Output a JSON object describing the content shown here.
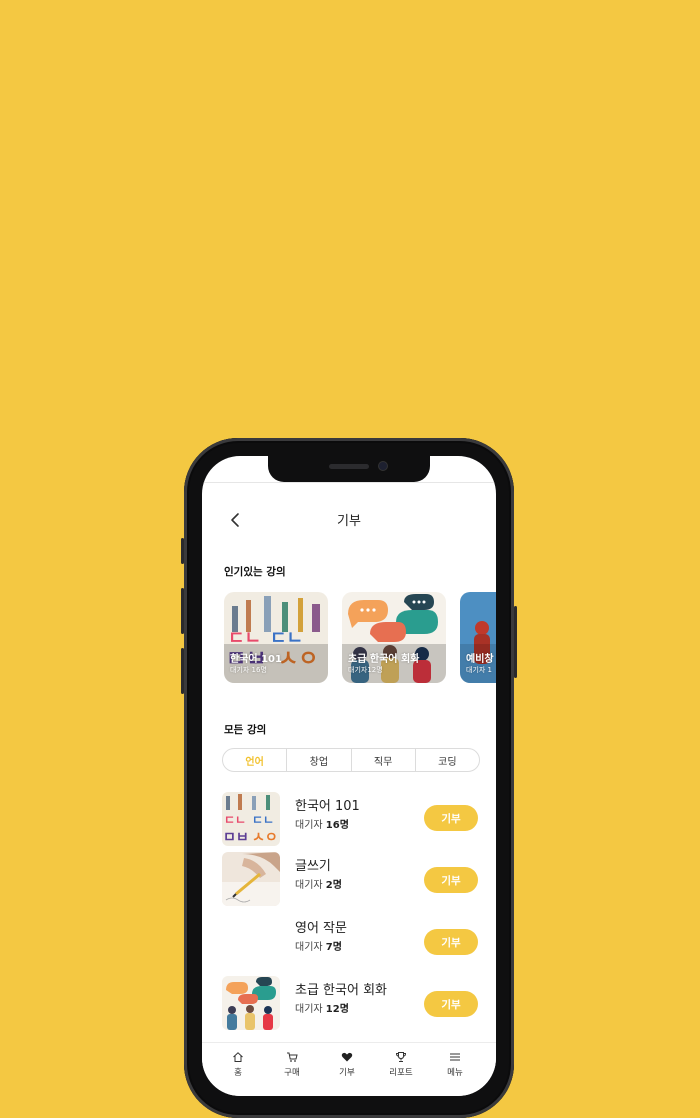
{
  "header": {
    "title": "기부"
  },
  "popular": {
    "heading": "인기있는 강의",
    "cards": [
      {
        "title": "한국어 101",
        "sub": "대기자 16명"
      },
      {
        "title": "초급 한국어 회화",
        "sub": "대기자12명"
      },
      {
        "title": "예비창",
        "sub": "대기자 1"
      }
    ]
  },
  "all": {
    "heading": "모든 강의",
    "tabs": [
      "언어",
      "창업",
      "직무",
      "코딩"
    ],
    "waiting_label": "대기자",
    "items": [
      {
        "name": "한국어 101",
        "count": "16명",
        "button": "기부"
      },
      {
        "name": "글쓰기",
        "count": "2명",
        "button": "기부"
      },
      {
        "name": "영어 작문",
        "count": "7명",
        "button": "기부"
      },
      {
        "name": "초급 한국어 회화",
        "count": "12명",
        "button": "기부"
      }
    ]
  },
  "nav": [
    {
      "label": "홈",
      "icon": "home-icon"
    },
    {
      "label": "구매",
      "icon": "cart-icon"
    },
    {
      "label": "기부",
      "icon": "heart-icon"
    },
    {
      "label": "리포트",
      "icon": "trophy-icon"
    },
    {
      "label": "메뉴",
      "icon": "menu-icon"
    }
  ],
  "colors": {
    "background": "#F4C842",
    "accent": "#F4C842",
    "active_tab": "#F2C230"
  }
}
